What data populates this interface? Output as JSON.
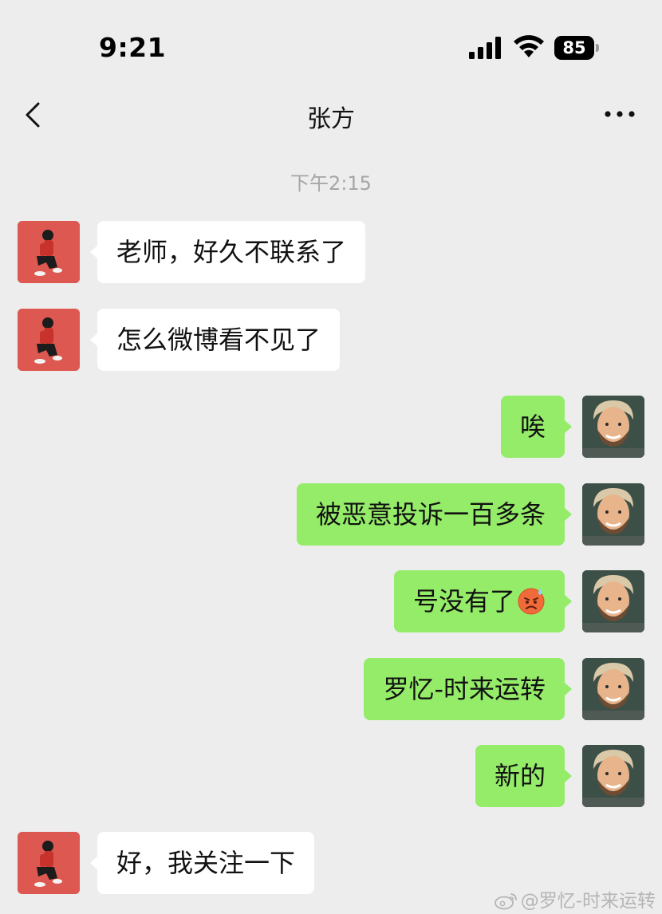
{
  "status_bar": {
    "time": "9:21",
    "battery": "85"
  },
  "header": {
    "title": "张方"
  },
  "chat": {
    "timestamp": "下午2:15",
    "messages": [
      {
        "side": "left",
        "text": "老师，好久不联系了"
      },
      {
        "side": "left",
        "text": "怎么微博看不见了"
      },
      {
        "side": "right",
        "text": "唉"
      },
      {
        "side": "right",
        "text": "被恶意投诉一百多条"
      },
      {
        "side": "right",
        "text": "号没有了",
        "emoji": "anxious-sweat-face-emoji"
      },
      {
        "side": "right",
        "text": "罗忆-时来运转"
      },
      {
        "side": "right",
        "text": "新的"
      },
      {
        "side": "left",
        "text": "好，我关注一下"
      }
    ]
  },
  "watermark": {
    "text": "@罗忆-时来运转",
    "icon": "weibo-icon"
  },
  "colors": {
    "background": "#ededed",
    "bubble_outgoing": "#95ec69",
    "bubble_incoming": "#ffffff",
    "timestamp": "#a6a6a6"
  }
}
